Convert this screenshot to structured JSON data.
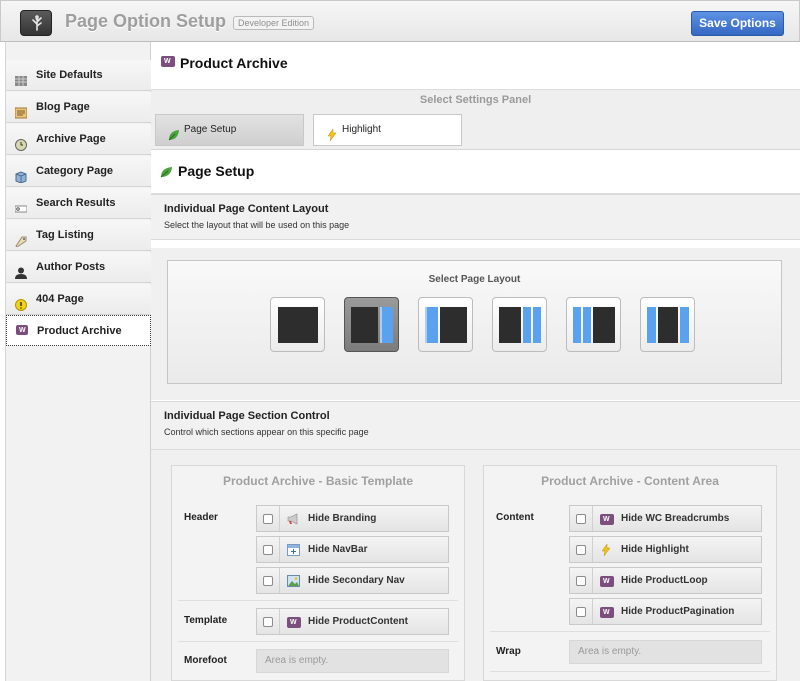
{
  "header": {
    "title": "Page Option Setup",
    "edition": "Developer Edition",
    "save_label": "Save Options"
  },
  "sidebar": {
    "items": [
      {
        "label": "Site Defaults",
        "icon": "grid-icon"
      },
      {
        "label": "Blog Page",
        "icon": "blog-icon"
      },
      {
        "label": "Archive Page",
        "icon": "clock-icon"
      },
      {
        "label": "Category Page",
        "icon": "cube-icon"
      },
      {
        "label": "Search Results",
        "icon": "search-bar-icon"
      },
      {
        "label": "Tag Listing",
        "icon": "tag-icon"
      },
      {
        "label": "Author Posts",
        "icon": "person-icon"
      },
      {
        "label": "404 Page",
        "icon": "warning-icon"
      },
      {
        "label": "Product Archive",
        "icon": "woo-icon",
        "active": true
      }
    ]
  },
  "main": {
    "title": "Product Archive",
    "panel_caption": "Select Settings Panel",
    "tabs": [
      {
        "label": "Page Setup",
        "active": true
      },
      {
        "label": "Highlight",
        "active": false
      }
    ],
    "page_setup_title": "Page Setup",
    "content_layout": {
      "title": "Individual Page Content Layout",
      "description": "Select the layout that will be used on this page",
      "caption": "Select Page Layout",
      "selected_index": 1
    },
    "section_control": {
      "title": "Individual Page Section Control",
      "description": "Control which sections appear on this specific page"
    },
    "basic_template": {
      "title": "Product Archive - Basic Template",
      "header_label": "Header",
      "header_options": [
        "Hide Branding",
        "Hide NavBar",
        "Hide Secondary Nav"
      ],
      "template_label": "Template",
      "template_options": [
        "Hide ProductContent"
      ],
      "morefoot_label": "Morefoot",
      "morefoot_empty": "Area is empty."
    },
    "content_area": {
      "title": "Product Archive - Content Area",
      "content_label": "Content",
      "content_options": [
        "Hide WC Breadcrumbs",
        "Hide Highlight",
        "Hide ProductLoop",
        "Hide ProductPagination"
      ],
      "wrap_label": "Wrap",
      "wrap_empty": "Area is empty."
    }
  },
  "colors": {
    "accent": "#3a6fc8",
    "woo": "#7b4e7e",
    "leaf": "#4aa33c"
  }
}
